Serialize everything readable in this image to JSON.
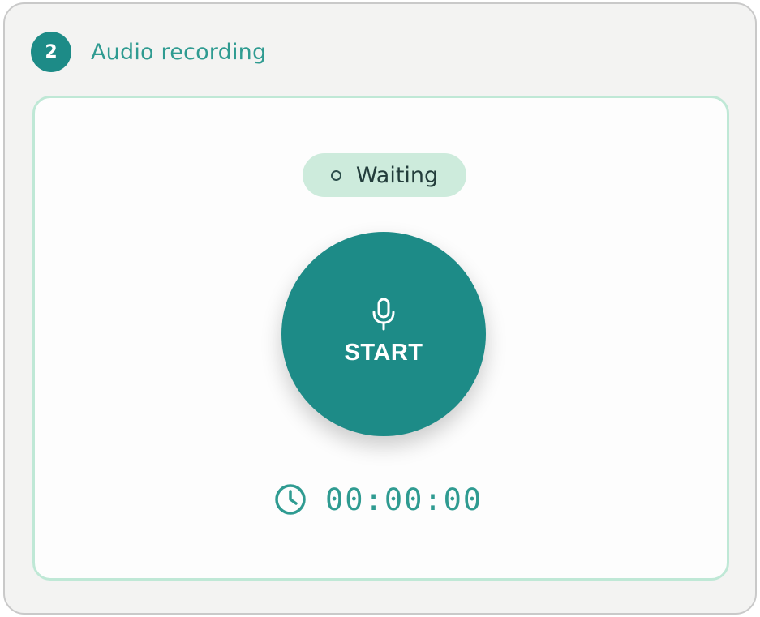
{
  "step": {
    "number": "2",
    "title": "Audio recording"
  },
  "status": {
    "text": "Waiting"
  },
  "record_button": {
    "label": "START",
    "icon": "microphone-icon"
  },
  "timer": {
    "icon": "clock-icon",
    "value": "00:00:00"
  },
  "colors": {
    "primary": "#1d8b87",
    "accent_text": "#2f9b91",
    "status_bg": "#cdebdc",
    "panel_border": "#bfe8d6",
    "card_bg": "#f3f3f2"
  }
}
